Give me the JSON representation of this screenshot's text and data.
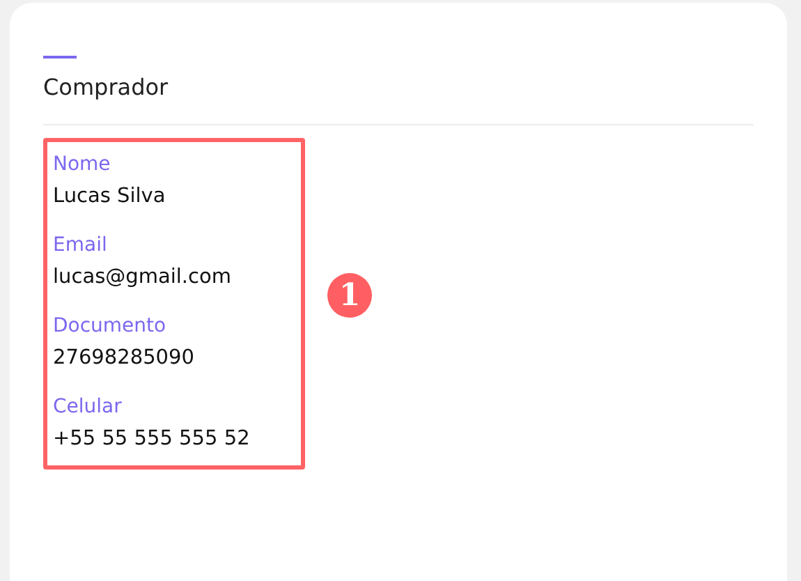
{
  "section": {
    "title": "Comprador"
  },
  "fields": [
    {
      "label": "Nome",
      "value": "Lucas Silva"
    },
    {
      "label": "Email",
      "value": "lucas@gmail.com"
    },
    {
      "label": "Documento",
      "value": "27698285090"
    },
    {
      "label": "Celular",
      "value": "+55 55 555 555 52"
    }
  ],
  "annotation": {
    "number": "1"
  }
}
